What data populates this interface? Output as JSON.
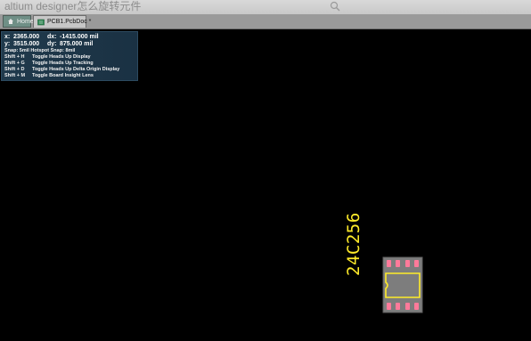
{
  "search": {
    "text": "altium designer怎么旋转元件"
  },
  "tabs": [
    {
      "label": "Home",
      "icon": "home-icon"
    },
    {
      "label": "PCB1.PcbDoc *",
      "icon": "pcb-document-icon"
    }
  ],
  "hud": {
    "x_label": "x:",
    "x_value": "2365.000",
    "dx_label": "dx:",
    "dx_value": "-1415.000 mil",
    "y_label": "y:",
    "y_value": "3515.000",
    "dy_label": "dy:",
    "dy_value": "875.000 mil",
    "snap": "Snap: 5mil Hotspot Snap: 8mil",
    "shortcuts": [
      {
        "key": "Shift + H",
        "action": "Toggle Heads Up Display"
      },
      {
        "key": "Shift + G",
        "action": "Toggle Heads Up Tracking"
      },
      {
        "key": "Shift + D",
        "action": "Toggle Heads Up Delta Origin Display"
      },
      {
        "key": "Shift + M",
        "action": "Toggle Board Insight Lens"
      }
    ]
  },
  "component": {
    "designator": "24C256",
    "designator_color": "#ffeb2a",
    "pad_color": "#ff7a9a",
    "body_color": "#7d7d7d",
    "outline_color": "#ffeb2a"
  }
}
